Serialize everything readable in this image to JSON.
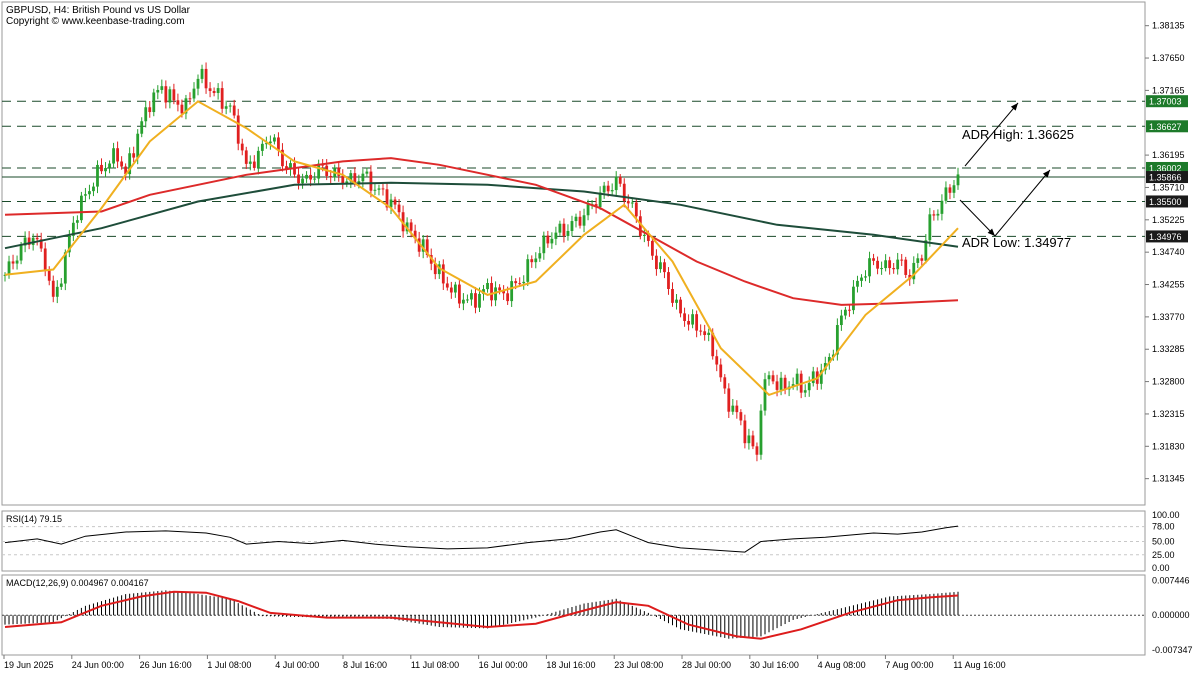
{
  "header": {
    "title": "GBPUSD, H4:  British Pound vs US Dollar",
    "copyright": "Copyright © www.keenbase-trading.com"
  },
  "colors": {
    "bull_candle": "#27a02f",
    "bear_candle": "#e02020",
    "ma_fast": "#f0b020",
    "ma_mid": "#dd2a2a",
    "ma_slow": "#1e4d3a",
    "rsi_line": "#000000",
    "macd_signal": "#dd1c1c",
    "macd_hist": "#000000",
    "level_tag_bg": "#1a1a1a",
    "green_tag_bg": "#1d7a2a",
    "grid": "#c8c8c8"
  },
  "annotations": {
    "adr_high": "ADR High: 1.36625",
    "adr_low": "ADR Low: 1.34977"
  },
  "chart_data": {
    "type": "candlestick",
    "symbol": "GBPUSD",
    "timeframe": "H4",
    "y_ticks": [
      "1.38135",
      "1.37650",
      "1.37165",
      "1.36195",
      "1.35710",
      "1.35225",
      "1.34740",
      "1.34255",
      "1.33770",
      "1.33285",
      "1.32800",
      "1.32315",
      "1.31830",
      "1.31345"
    ],
    "x_ticks": [
      "19 Jun 2025",
      "24 Jun 00:00",
      "26 Jun 16:00",
      "1 Jul 08:00",
      "4 Jul 00:00",
      "8 Jul 16:00",
      "11 Jul 08:00",
      "16 Jul 00:00",
      "18 Jul 16:00",
      "23 Jul 08:00",
      "28 Jul 00:00",
      "30 Jul 16:00",
      "4 Aug 08:00",
      "7 Aug 00:00",
      "11 Aug 16:00"
    ],
    "ylim": [
      1.311,
      1.384
    ],
    "price_levels": [
      {
        "value": 1.37003,
        "label": "1.37003",
        "style": "green_tag",
        "line": "dashed"
      },
      {
        "value": 1.36627,
        "label": "1.36627",
        "style": "green_tag",
        "line": "dashed"
      },
      {
        "value": 1.36002,
        "label": "1.36002",
        "style": "green_tag",
        "line": "dashed"
      },
      {
        "value": 1.35866,
        "label": "1.35866",
        "style": "dark_tag",
        "line": "solid"
      },
      {
        "value": 1.355,
        "label": "1.35500",
        "style": "dark_tag",
        "line": "dashed"
      },
      {
        "value": 1.34976,
        "label": "1.34976",
        "style": "dark_tag",
        "line": "dashed"
      }
    ],
    "close_path": [
      [
        0,
        1.344
      ],
      [
        4,
        1.348
      ],
      [
        7,
        1.35
      ],
      [
        10,
        1.346
      ],
      [
        12,
        1.34
      ],
      [
        14,
        1.344
      ],
      [
        17,
        1.352
      ],
      [
        20,
        1.356
      ],
      [
        24,
        1.36
      ],
      [
        28,
        1.362
      ],
      [
        30,
        1.359
      ],
      [
        33,
        1.365
      ],
      [
        36,
        1.37
      ],
      [
        39,
        1.372
      ],
      [
        42,
        1.37
      ],
      [
        45,
        1.369
      ],
      [
        48,
        1.374
      ],
      [
        51,
        1.372
      ],
      [
        54,
        1.37
      ],
      [
        56,
        1.369
      ],
      [
        58,
        1.365
      ],
      [
        60,
        1.36
      ],
      [
        63,
        1.362
      ],
      [
        66,
        1.365
      ],
      [
        69,
        1.361
      ],
      [
        72,
        1.359
      ],
      [
        75,
        1.358
      ],
      [
        78,
        1.36
      ],
      [
        82,
        1.359
      ],
      [
        86,
        1.358
      ],
      [
        89,
        1.359
      ],
      [
        92,
        1.357
      ],
      [
        96,
        1.355
      ],
      [
        100,
        1.351
      ],
      [
        104,
        1.348
      ],
      [
        108,
        1.344
      ],
      [
        112,
        1.341
      ],
      [
        116,
        1.34
      ],
      [
        120,
        1.342
      ],
      [
        124,
        1.341
      ],
      [
        128,
        1.343
      ],
      [
        132,
        1.347
      ],
      [
        136,
        1.35
      ],
      [
        140,
        1.351
      ],
      [
        144,
        1.353
      ],
      [
        148,
        1.356
      ],
      [
        152,
        1.358
      ],
      [
        154,
        1.356
      ],
      [
        156,
        1.354
      ],
      [
        158,
        1.351
      ],
      [
        161,
        1.347
      ],
      [
        164,
        1.344
      ],
      [
        167,
        1.339
      ],
      [
        170,
        1.337
      ],
      [
        173,
        1.336
      ],
      [
        176,
        1.333
      ],
      [
        179,
        1.326
      ],
      [
        182,
        1.323
      ],
      [
        185,
        1.319
      ],
      [
        187,
        1.317
      ],
      [
        188,
        1.325
      ],
      [
        190,
        1.329
      ],
      [
        193,
        1.327
      ],
      [
        196,
        1.328
      ],
      [
        199,
        1.327
      ],
      [
        202,
        1.329
      ],
      [
        205,
        1.331
      ],
      [
        207,
        1.336
      ],
      [
        210,
        1.34
      ],
      [
        213,
        1.344
      ],
      [
        216,
        1.346
      ],
      [
        219,
        1.345
      ],
      [
        222,
        1.346
      ],
      [
        225,
        1.344
      ],
      [
        228,
        1.347
      ],
      [
        230,
        1.352
      ],
      [
        232,
        1.354
      ],
      [
        234,
        1.356
      ],
      [
        236,
        1.358
      ],
      [
        237,
        1.3586
      ]
    ],
    "ma_fast_path": [
      [
        0,
        1.344
      ],
      [
        12,
        1.3448
      ],
      [
        24,
        1.354
      ],
      [
        36,
        1.364
      ],
      [
        48,
        1.37
      ],
      [
        60,
        1.366
      ],
      [
        72,
        1.361
      ],
      [
        84,
        1.359
      ],
      [
        96,
        1.354
      ],
      [
        108,
        1.345
      ],
      [
        120,
        1.341
      ],
      [
        132,
        1.343
      ],
      [
        144,
        1.35
      ],
      [
        154,
        1.3545
      ],
      [
        166,
        1.346
      ],
      [
        178,
        1.333
      ],
      [
        190,
        1.326
      ],
      [
        202,
        1.3285
      ],
      [
        214,
        1.338
      ],
      [
        226,
        1.344
      ],
      [
        237,
        1.351
      ]
    ],
    "ma_mid_path": [
      [
        0,
        1.353
      ],
      [
        24,
        1.3535
      ],
      [
        36,
        1.356
      ],
      [
        60,
        1.359
      ],
      [
        84,
        1.361
      ],
      [
        96,
        1.3615
      ],
      [
        108,
        1.3605
      ],
      [
        132,
        1.3575
      ],
      [
        148,
        1.354
      ],
      [
        160,
        1.35
      ],
      [
        172,
        1.346
      ],
      [
        184,
        1.343
      ],
      [
        196,
        1.3405
      ],
      [
        208,
        1.3395
      ],
      [
        220,
        1.3397
      ],
      [
        237,
        1.3402
      ]
    ],
    "ma_slow_path": [
      [
        0,
        1.348
      ],
      [
        24,
        1.351
      ],
      [
        48,
        1.355
      ],
      [
        72,
        1.3575
      ],
      [
        96,
        1.3578
      ],
      [
        120,
        1.3575
      ],
      [
        144,
        1.3565
      ],
      [
        168,
        1.3545
      ],
      [
        192,
        1.3515
      ],
      [
        216,
        1.35
      ],
      [
        237,
        1.3482
      ]
    ],
    "rsi": {
      "label": "RSI(14) 79.15",
      "value": 79.15,
      "ticks": [
        "100.00",
        "78.00",
        "50.00",
        "25.00",
        "0.00"
      ],
      "path": [
        [
          0,
          48
        ],
        [
          8,
          55
        ],
        [
          14,
          45
        ],
        [
          20,
          60
        ],
        [
          30,
          68
        ],
        [
          40,
          70
        ],
        [
          50,
          66
        ],
        [
          56,
          58
        ],
        [
          60,
          45
        ],
        [
          68,
          50
        ],
        [
          76,
          46
        ],
        [
          84,
          52
        ],
        [
          92,
          45
        ],
        [
          100,
          40
        ],
        [
          110,
          36
        ],
        [
          120,
          38
        ],
        [
          130,
          48
        ],
        [
          140,
          55
        ],
        [
          148,
          68
        ],
        [
          152,
          72
        ],
        [
          156,
          60
        ],
        [
          160,
          48
        ],
        [
          168,
          38
        ],
        [
          176,
          34
        ],
        [
          184,
          30
        ],
        [
          188,
          50
        ],
        [
          196,
          55
        ],
        [
          204,
          58
        ],
        [
          210,
          62
        ],
        [
          216,
          66
        ],
        [
          222,
          64
        ],
        [
          228,
          68
        ],
        [
          234,
          76
        ],
        [
          237,
          79
        ]
      ]
    },
    "macd": {
      "label": "MACD(12,26,9) 0.004967 0.004167",
      "ticks": [
        "0.007446",
        "0.000000",
        "-0.007347"
      ],
      "ylim": [
        -0.0074,
        0.0075
      ],
      "hist_path": [
        [
          0,
          -0.002
        ],
        [
          12,
          -0.0015
        ],
        [
          20,
          0.002
        ],
        [
          30,
          0.0045
        ],
        [
          40,
          0.0053
        ],
        [
          48,
          0.0045
        ],
        [
          56,
          0.0035
        ],
        [
          64,
          -0.0002
        ],
        [
          80,
          -0.0005
        ],
        [
          96,
          -0.0008
        ],
        [
          108,
          -0.0025
        ],
        [
          120,
          -0.0028
        ],
        [
          132,
          -0.0005
        ],
        [
          144,
          0.0025
        ],
        [
          152,
          0.0035
        ],
        [
          160,
          0.0005
        ],
        [
          168,
          -0.003
        ],
        [
          180,
          -0.005
        ],
        [
          188,
          -0.0045
        ],
        [
          196,
          -0.001
        ],
        [
          208,
          0.0015
        ],
        [
          220,
          0.004
        ],
        [
          230,
          0.0045
        ],
        [
          237,
          0.005
        ]
      ],
      "signal_path": [
        [
          0,
          -0.0025
        ],
        [
          14,
          -0.0015
        ],
        [
          24,
          0.002
        ],
        [
          34,
          0.004
        ],
        [
          42,
          0.005
        ],
        [
          50,
          0.0048
        ],
        [
          58,
          0.003
        ],
        [
          66,
          0.0005
        ],
        [
          80,
          -0.0005
        ],
        [
          96,
          -0.0005
        ],
        [
          108,
          -0.0015
        ],
        [
          120,
          -0.0025
        ],
        [
          132,
          -0.0018
        ],
        [
          144,
          0.001
        ],
        [
          152,
          0.0028
        ],
        [
          160,
          0.002
        ],
        [
          170,
          -0.002
        ],
        [
          182,
          -0.0045
        ],
        [
          188,
          -0.005
        ],
        [
          198,
          -0.003
        ],
        [
          210,
          0.0005
        ],
        [
          222,
          0.0032
        ],
        [
          230,
          0.0038
        ],
        [
          237,
          0.0042
        ]
      ]
    }
  }
}
